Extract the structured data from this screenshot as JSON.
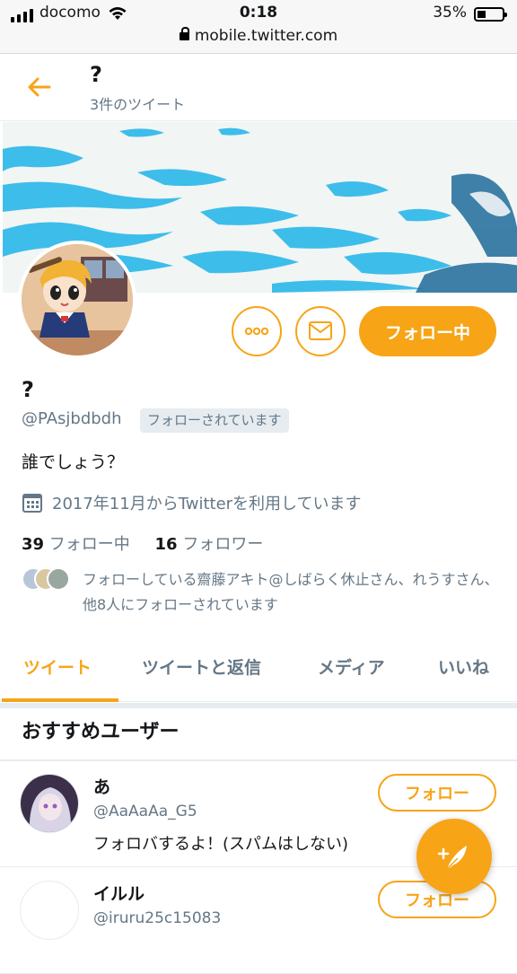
{
  "status_bar": {
    "carrier": "docomo",
    "time": "0:18",
    "battery": "35%",
    "battery_level": 0.35,
    "url": "mobile.twitter.com"
  },
  "header": {
    "title": "?",
    "subtitle": "3件のツイート"
  },
  "profile": {
    "name": "?",
    "handle": "@PAsjbdbdh",
    "follows_you_badge": "フォローされています",
    "bio": "誰でしょう？",
    "joined": "2017年11月からTwitterを利用しています",
    "following_count": "39",
    "following_label": "フォロー中",
    "followers_count": "16",
    "followers_label": "フォロワー",
    "mutual_text": "フォローしている齋藤アキト@しばらく休止さん、れうすさん、他8人にフォローされています",
    "follow_state_label": "フォロー中"
  },
  "tabs": [
    {
      "label": "ツイート",
      "active": true
    },
    {
      "label": "ツイートと返信",
      "active": false
    },
    {
      "label": "メディア",
      "active": false
    },
    {
      "label": "いいね",
      "active": false
    }
  ],
  "recommendations": {
    "title": "おすすめユーザー",
    "users": [
      {
        "name": "あ",
        "handle": "@AaAaAa_G5",
        "bio": "フォロバするよ！(スパムはしない)",
        "button": "フォロー"
      },
      {
        "name": "イルル",
        "handle": "@iruru25c15083",
        "bio": "",
        "button": "フォロー"
      }
    ]
  },
  "colors": {
    "accent": "#f7a416",
    "secondary_text": "#657786"
  },
  "icons": {
    "back": "arrow-left-icon",
    "more": "more-dots-icon",
    "message": "envelope-icon",
    "calendar": "calendar-icon",
    "compose": "compose-feather-icon"
  }
}
